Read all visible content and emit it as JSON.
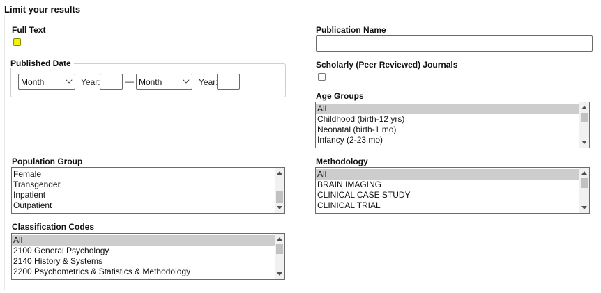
{
  "legend": "Limit your results",
  "full_text": {
    "label": "Full Text",
    "checked": false
  },
  "published_date": {
    "label": "Published Date",
    "month_start": "Month",
    "year_start_label": "Year:",
    "dash": "—",
    "month_end": "Month",
    "year_end_label": "Year:"
  },
  "publication_name": {
    "label": "Publication Name",
    "value": ""
  },
  "scholarly": {
    "label": "Scholarly (Peer Reviewed) Journals",
    "checked": false
  },
  "age_groups": {
    "label": "Age Groups",
    "items": [
      "All",
      "Childhood (birth-12 yrs)",
      "Neonatal (birth-1 mo)",
      "Infancy (2-23 mo)"
    ],
    "selected": "All"
  },
  "population_group": {
    "label": "Population Group",
    "items": [
      "Female",
      "Transgender",
      "Inpatient",
      "Outpatient"
    ]
  },
  "methodology": {
    "label": "Methodology",
    "items": [
      "All",
      "BRAIN IMAGING",
      "CLINICAL CASE STUDY",
      "CLINICAL TRIAL"
    ],
    "selected": "All"
  },
  "classification_codes": {
    "label": "Classification Codes",
    "items": [
      "All",
      "2100 General Psychology",
      "2140 History & Systems",
      "2200 Psychometrics & Statistics & Methodology"
    ],
    "selected": "All"
  },
  "colors": {
    "highlight_checkbox": "#f4f400",
    "selected_item": "#cdcdcd"
  },
  "icons": [
    "chevron-down-icon",
    "scroll-up-arrow-icon",
    "scroll-down-arrow-icon"
  ]
}
